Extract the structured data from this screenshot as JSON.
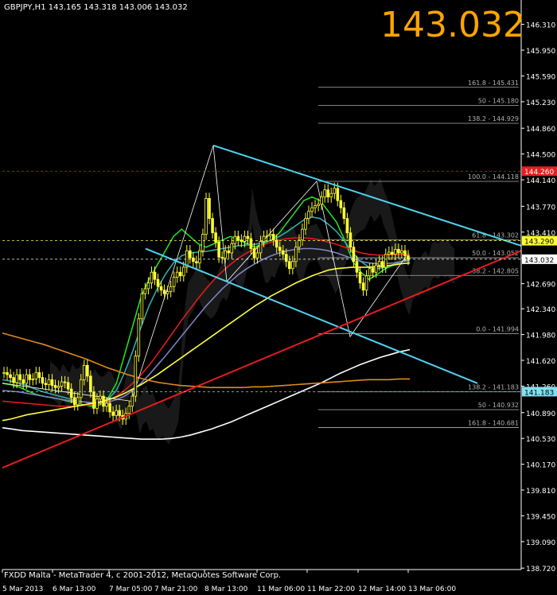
{
  "header": {
    "symbol_info": "GBPJPY,H1  143.165 143.318 143.006 143.032",
    "big_price": "143.032"
  },
  "footer": {
    "copyright": "FXDD Malta - MetaTrader 4, c 2001-2012, MetaQuotes Software Corp."
  },
  "colors": {
    "background": "#000000",
    "axis": "#ffffff",
    "candle": "#ffff33",
    "ma_green": "#22dd22",
    "ma_cyan": "#33aaaa",
    "ma_red": "#e21b1b",
    "ma_purple": "#8080c0",
    "ma_yellow": "#ffff40",
    "ma_white": "#ffffff",
    "ma_orange": "#e08a1e",
    "channel": "#4fd3f0",
    "trend_red": "#e81c1c",
    "fib": "#b0b0b0",
    "marker_red": "#e51f1f",
    "marker_yellow": "#ffff33",
    "marker_white": "#ffffff",
    "marker_cyan": "#7fe0f0"
  },
  "chart_data": {
    "type": "line",
    "title": "",
    "ylim": [
      138.7,
      146.45
    ],
    "y_ticks": [
      "146.310",
      "145.950",
      "145.590",
      "145.230",
      "144.860",
      "144.500",
      "144.140",
      "143.770",
      "143.410",
      "143.050",
      "142.690",
      "142.340",
      "141.980",
      "141.620",
      "141.260",
      "140.890",
      "140.530",
      "140.170",
      "139.810",
      "139.450",
      "139.090",
      "138.720"
    ],
    "x_labels": [
      "5 Mar 2013",
      "6 Mar 13:00",
      "7 Mar 05:00",
      "7 Mar 21:00",
      "8 Mar 13:00",
      "11 Mar 06:00",
      "11 Mar 22:00",
      "12 Mar 14:00",
      "13 Mar 06:00"
    ],
    "bars": 160,
    "close_series": [
      141.45,
      141.42,
      141.38,
      141.31,
      141.42,
      141.35,
      141.3,
      141.42,
      141.35,
      141.36,
      141.45,
      141.38,
      141.3,
      141.28,
      141.35,
      141.27,
      141.24,
      141.26,
      141.32,
      141.31,
      141.22,
      141.1,
      141.0,
      141.1,
      141.35,
      141.55,
      141.4,
      141.18,
      140.95,
      141.08,
      141.12,
      140.98,
      141.02,
      140.9,
      140.85,
      140.92,
      140.85,
      140.8,
      140.88,
      140.98,
      141.12,
      141.68,
      142.2,
      142.55,
      142.62,
      142.7,
      142.85,
      142.75,
      142.65,
      142.6,
      142.55,
      142.58,
      142.65,
      142.78,
      142.85,
      142.8,
      142.92,
      143.15,
      143.05,
      143.0,
      142.98,
      143.15,
      143.38,
      143.88,
      143.6,
      143.4,
      143.27,
      143.06,
      143.05,
      143.15,
      143.12,
      143.25,
      143.35,
      143.3,
      143.28,
      143.35,
      143.32,
      143.18,
      143.05,
      143.12,
      143.28,
      143.35,
      143.36,
      143.38,
      143.3,
      143.2,
      143.15,
      143.1,
      143.0,
      142.9,
      143.0,
      143.2,
      143.3,
      143.45,
      143.6,
      143.7,
      143.75,
      143.78,
      143.8,
      143.9,
      144.0,
      143.9,
      143.95,
      144.02,
      143.85,
      143.75,
      143.6,
      143.4,
      143.2,
      143.0,
      142.85,
      142.7,
      142.6,
      142.8,
      142.9,
      142.85,
      142.95,
      143.0,
      142.92,
      143.1,
      143.13,
      143.1,
      143.17,
      143.12,
      143.15,
      143.08,
      143.03
    ],
    "moving_averages": [
      {
        "color": "#22dd22",
        "y": [
          141.3,
          141.28,
          141.25,
          141.2,
          141.15,
          141.12,
          141.1,
          141.08,
          141.05,
          141.03,
          141.0,
          140.98,
          141.0,
          141.1,
          141.3,
          141.7,
          142.1,
          142.5,
          142.75,
          142.95,
          143.15,
          143.35,
          143.45,
          143.35,
          143.25,
          143.2,
          143.25,
          143.3,
          143.35,
          143.3,
          143.25,
          143.2,
          143.25,
          143.3,
          143.4,
          143.55,
          143.7,
          143.85,
          143.9,
          143.85,
          143.7,
          143.55,
          143.3,
          143.0,
          142.85,
          142.75,
          142.82,
          142.9,
          142.95,
          143.0,
          143.05
        ]
      },
      {
        "color": "#33aaaa",
        "y": [
          141.35,
          141.33,
          141.3,
          141.27,
          141.22,
          141.18,
          141.15,
          141.12,
          141.09,
          141.06,
          141.04,
          141.02,
          141.02,
          141.08,
          141.2,
          141.45,
          141.75,
          142.08,
          142.38,
          142.62,
          142.82,
          142.98,
          143.08,
          143.12,
          143.13,
          143.14,
          143.16,
          143.18,
          143.2,
          143.22,
          143.23,
          143.24,
          143.26,
          143.3,
          143.35,
          143.42,
          143.5,
          143.58,
          143.62,
          143.6,
          143.52,
          143.42,
          143.28,
          143.12,
          143.0,
          142.92,
          142.9,
          142.92,
          142.96,
          143.0,
          143.02
        ]
      },
      {
        "color": "#e21b1b",
        "y": [
          141.05,
          141.04,
          141.03,
          141.02,
          141.01,
          141.0,
          140.99,
          140.98,
          140.98,
          140.98,
          140.99,
          141.0,
          141.02,
          141.06,
          141.12,
          141.2,
          141.3,
          141.42,
          141.55,
          141.7,
          141.86,
          142.02,
          142.18,
          142.33,
          142.48,
          142.62,
          142.75,
          142.86,
          142.96,
          143.05,
          143.12,
          143.18,
          143.23,
          143.27,
          143.3,
          143.32,
          143.33,
          143.33,
          143.32,
          143.3,
          143.27,
          143.24,
          143.2,
          143.16,
          143.12,
          143.1,
          143.09,
          143.09,
          143.1,
          143.1,
          143.1
        ]
      },
      {
        "color": "#8080c0",
        "y": [
          141.2,
          141.19,
          141.18,
          141.16,
          141.14,
          141.12,
          141.1,
          141.08,
          141.06,
          141.05,
          141.04,
          141.03,
          141.03,
          141.04,
          141.07,
          141.12,
          141.2,
          141.3,
          141.42,
          141.55,
          141.68,
          141.82,
          141.96,
          142.1,
          142.24,
          142.38,
          142.5,
          142.62,
          142.72,
          142.82,
          142.9,
          142.97,
          143.03,
          143.08,
          143.12,
          143.15,
          143.17,
          143.18,
          143.18,
          143.17,
          143.15,
          143.12,
          143.08,
          143.04,
          143.0,
          142.98,
          142.97,
          142.97,
          142.98,
          143.0,
          143.01
        ]
      },
      {
        "color": "#ffff40",
        "y": [
          140.78,
          140.8,
          140.83,
          140.86,
          140.88,
          140.9,
          140.92,
          140.94,
          140.96,
          140.98,
          141.0,
          141.02,
          141.04,
          141.07,
          141.11,
          141.16,
          141.22,
          141.28,
          141.35,
          141.42,
          141.5,
          141.58,
          141.66,
          141.74,
          141.82,
          141.9,
          141.98,
          142.06,
          142.14,
          142.22,
          142.3,
          142.38,
          142.45,
          142.52,
          142.58,
          142.64,
          142.7,
          142.75,
          142.8,
          142.84,
          142.88,
          142.9,
          142.91,
          142.92,
          142.92,
          142.92,
          142.93,
          142.94,
          142.95,
          142.97,
          142.98
        ]
      },
      {
        "color": "#ffffff",
        "y": [
          140.68,
          140.66,
          140.64,
          140.63,
          140.62,
          140.61,
          140.6,
          140.59,
          140.58,
          140.57,
          140.56,
          140.55,
          140.54,
          140.53,
          140.52,
          140.52,
          140.52,
          140.53,
          140.55,
          140.58,
          140.62,
          140.66,
          140.71,
          140.76,
          140.82,
          140.88,
          140.94,
          141.0,
          141.06,
          141.12,
          141.18,
          141.24,
          141.3,
          141.37,
          141.44,
          141.5,
          141.56,
          141.61,
          141.66,
          141.7,
          141.74,
          141.77
        ]
      },
      {
        "color": "#e08a1e",
        "y": [
          142.0,
          141.96,
          141.92,
          141.88,
          141.84,
          141.79,
          141.74,
          141.69,
          141.64,
          141.58,
          141.52,
          141.47,
          141.42,
          141.38,
          141.34,
          141.31,
          141.29,
          141.27,
          141.26,
          141.25,
          141.24,
          141.24,
          141.24,
          141.24,
          141.25,
          141.25,
          141.26,
          141.27,
          141.28,
          141.29,
          141.3,
          141.31,
          141.32,
          141.33,
          141.34,
          141.35,
          141.35,
          141.35,
          141.36,
          141.36
        ]
      }
    ],
    "fibonacci_levels": [
      {
        "label": "161.8 - 145.431",
        "value": 145.431
      },
      {
        "label": "50 - 145.180",
        "value": 145.18
      },
      {
        "label": "138.2 - 144.929",
        "value": 144.929
      },
      {
        "label": "100.0 - 144.118",
        "value": 144.118
      },
      {
        "label": "61.8 - 143.302",
        "value": 143.302
      },
      {
        "label": "50.0 - 143.052",
        "value": 143.052
      },
      {
        "label": "38.2 - 142.805",
        "value": 142.805
      },
      {
        "label": "0.0 - 141.994",
        "value": 141.994
      },
      {
        "label": "138.2 - 141.183",
        "value": 141.183
      },
      {
        "label": "50 - 140.932",
        "value": 140.932
      },
      {
        "label": "161.8 - 140.681",
        "value": 140.681
      }
    ],
    "price_markers": [
      {
        "label": "144.260",
        "value": 144.26,
        "color": "#e51f1f"
      },
      {
        "label": "143.290",
        "value": 143.29,
        "color": "#ffff33"
      },
      {
        "label": "143.032",
        "value": 143.032,
        "color": "#ffffff"
      },
      {
        "label": "141.183",
        "value": 141.183,
        "color": "#7fe0f0"
      }
    ],
    "grid": false
  }
}
